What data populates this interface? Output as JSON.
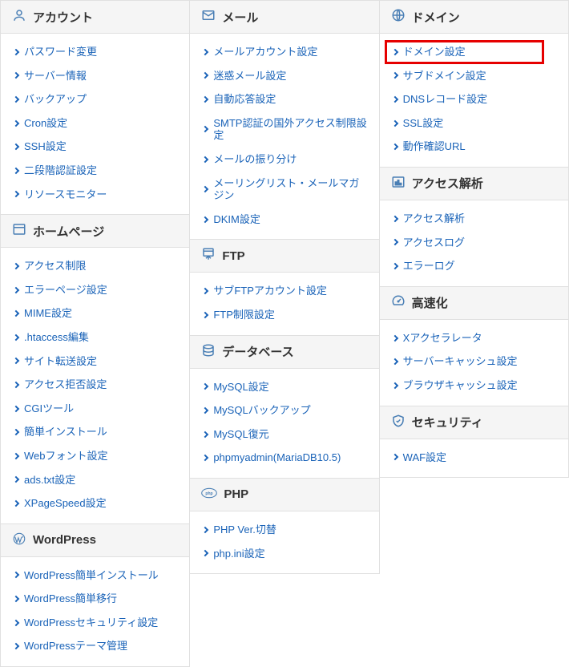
{
  "columns": [
    [
      {
        "icon": "user",
        "title": "アカウント",
        "items": [
          "パスワード変更",
          "サーバー情報",
          "バックアップ",
          "Cron設定",
          "SSH設定",
          "二段階認証設定",
          "リソースモニター"
        ]
      },
      {
        "icon": "window",
        "title": "ホームページ",
        "items": [
          "アクセス制限",
          "エラーページ設定",
          "MIME設定",
          ".htaccess編集",
          "サイト転送設定",
          "アクセス拒否設定",
          "CGIツール",
          "簡単インストール",
          "Webフォント設定",
          "ads.txt設定",
          "XPageSpeed設定"
        ]
      },
      {
        "icon": "wordpress",
        "title": "WordPress",
        "items": [
          "WordPress簡単インストール",
          "WordPress簡単移行",
          "WordPressセキュリティ設定",
          "WordPressテーマ管理"
        ]
      }
    ],
    [
      {
        "icon": "mail",
        "title": "メール",
        "items": [
          "メールアカウント設定",
          "迷惑メール設定",
          "自動応答設定",
          "SMTP認証の国外アクセス制限設定",
          "メールの振り分け",
          "メーリングリスト・メールマガジン",
          "DKIM設定"
        ]
      },
      {
        "icon": "ftp",
        "title": "FTP",
        "items": [
          "サブFTPアカウント設定",
          "FTP制限設定"
        ]
      },
      {
        "icon": "database",
        "title": "データベース",
        "items": [
          "MySQL設定",
          "MySQLバックアップ",
          "MySQL復元",
          "phpmyadmin(MariaDB10.5)"
        ]
      },
      {
        "icon": "php",
        "title": "PHP",
        "items": [
          "PHP Ver.切替",
          "php.ini設定"
        ]
      }
    ],
    [
      {
        "icon": "globe",
        "title": "ドメイン",
        "items": [
          "ドメイン設定",
          "サブドメイン設定",
          "DNSレコード設定",
          "SSL設定",
          "動作確認URL"
        ],
        "highlight_index": 0
      },
      {
        "icon": "chart",
        "title": "アクセス解析",
        "items": [
          "アクセス解析",
          "アクセスログ",
          "エラーログ"
        ]
      },
      {
        "icon": "speed",
        "title": "高速化",
        "items": [
          "Xアクセラレータ",
          "サーバーキャッシュ設定",
          "ブラウザキャッシュ設定"
        ]
      },
      {
        "icon": "shield",
        "title": "セキュリティ",
        "items": [
          "WAF設定"
        ]
      }
    ]
  ]
}
